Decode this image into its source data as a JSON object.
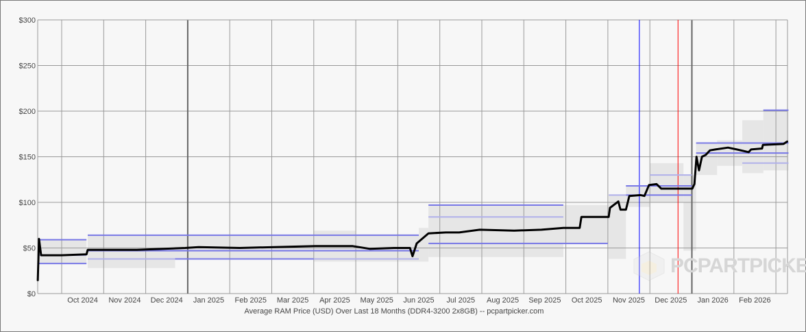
{
  "watermark": "PCPARTPICKER",
  "chart_data": {
    "type": "line",
    "title": "Average RAM Price (USD) Over Last 18 Months (DDR4-3200 2x8GB) -- pcpartpicker.com",
    "xlabel": "Average RAM Price (USD) Over Last 18 Months (DDR4-3200 2x8GB) -- pcpartpicker.com",
    "ylabel": "",
    "x_units": "months since 2024-09-01",
    "xlim": [
      0.43,
      18.36
    ],
    "ylim": [
      0,
      300
    ],
    "grid": true,
    "y_ticks": [
      {
        "value": 0,
        "label": "$0"
      },
      {
        "value": 50,
        "label": "$50"
      },
      {
        "value": 100,
        "label": "$100"
      },
      {
        "value": 150,
        "label": "$150"
      },
      {
        "value": 200,
        "label": "$200"
      },
      {
        "value": 250,
        "label": "$250"
      },
      {
        "value": 300,
        "label": "$300"
      }
    ],
    "x_ticks": [
      {
        "value": 1,
        "label": "Oct 2024"
      },
      {
        "value": 2,
        "label": "Nov 2024"
      },
      {
        "value": 3,
        "label": "Dec 2024"
      },
      {
        "value": 4,
        "label": "Jan 2025"
      },
      {
        "value": 5,
        "label": "Feb 2025"
      },
      {
        "value": 6,
        "label": "Mar 2025"
      },
      {
        "value": 7,
        "label": "Apr 2025"
      },
      {
        "value": 8,
        "label": "May 2025"
      },
      {
        "value": 9,
        "label": "Jun 2025"
      },
      {
        "value": 10,
        "label": "Jul 2025"
      },
      {
        "value": 11,
        "label": "Aug 2025"
      },
      {
        "value": 12,
        "label": "Sep 2025"
      },
      {
        "value": 13,
        "label": "Oct 2025"
      },
      {
        "value": 14,
        "label": "Nov 2025"
      },
      {
        "value": 15,
        "label": "Dec 2025"
      },
      {
        "value": 16,
        "label": "Jan 2026"
      },
      {
        "value": 17,
        "label": "Feb 2026"
      },
      {
        "value": 18,
        "label": ""
      }
    ],
    "year_lines": [
      4,
      16
    ],
    "marker_lines": [
      {
        "x": 14.75,
        "color": "#0000ff"
      },
      {
        "x": 15.67,
        "color": "#ff0000"
      }
    ],
    "range_bands": [
      [
        0.46,
        1.59,
        33,
        59
      ],
      [
        1.62,
        3.7,
        28,
        64
      ],
      [
        3.7,
        7.0,
        38,
        64
      ],
      [
        7.0,
        8.0,
        35,
        69
      ],
      [
        8.0,
        9.5,
        35,
        65
      ],
      [
        9.5,
        9.73,
        35,
        72
      ],
      [
        9.73,
        12.94,
        40,
        97
      ],
      [
        12.94,
        14.02,
        55,
        97
      ],
      [
        14.02,
        14.43,
        38,
        108
      ],
      [
        14.43,
        15.0,
        95,
        118
      ],
      [
        15.0,
        15.8,
        100,
        143
      ],
      [
        15.8,
        16.1,
        47,
        130
      ],
      [
        16.1,
        16.6,
        130,
        165
      ],
      [
        16.6,
        17.2,
        140,
        168
      ],
      [
        17.2,
        17.7,
        132,
        190
      ],
      [
        17.7,
        18.3,
        135,
        201
      ]
    ],
    "retailer_lines": [
      [
        0.46,
        1.59,
        59
      ],
      [
        0.46,
        1.59,
        33
      ],
      [
        0.46,
        1.59,
        42
      ],
      [
        1.62,
        9.5,
        64
      ],
      [
        1.62,
        9.5,
        47
      ],
      [
        1.62,
        9.5,
        38
      ],
      [
        3.7,
        7.0,
        38
      ],
      [
        9.73,
        12.94,
        97
      ],
      [
        9.73,
        12.94,
        84
      ],
      [
        9.73,
        12.94,
        55
      ],
      [
        12.94,
        14.0,
        55
      ],
      [
        14.02,
        14.43,
        108
      ],
      [
        14.43,
        16.0,
        118
      ],
      [
        14.43,
        16.0,
        108
      ],
      [
        15.0,
        16.0,
        130
      ],
      [
        16.1,
        18.3,
        165
      ],
      [
        16.1,
        18.3,
        154
      ],
      [
        17.2,
        18.3,
        143
      ],
      [
        17.7,
        18.3,
        201
      ]
    ],
    "series": [
      {
        "name": "Average price",
        "color": "#000000",
        "points": [
          [
            0.43,
            14
          ],
          [
            0.46,
            60
          ],
          [
            0.51,
            42
          ],
          [
            1.0,
            42
          ],
          [
            1.59,
            43
          ],
          [
            1.62,
            48
          ],
          [
            2.79,
            48
          ],
          [
            3.94,
            50
          ],
          [
            4.26,
            51
          ],
          [
            5.24,
            50
          ],
          [
            6.06,
            51
          ],
          [
            7.04,
            52
          ],
          [
            7.93,
            52
          ],
          [
            8.34,
            49
          ],
          [
            8.91,
            50
          ],
          [
            9.29,
            50
          ],
          [
            9.35,
            41
          ],
          [
            9.45,
            55
          ],
          [
            9.73,
            66
          ],
          [
            10.14,
            67
          ],
          [
            10.46,
            67
          ],
          [
            10.95,
            70
          ],
          [
            11.77,
            69
          ],
          [
            12.42,
            70
          ],
          [
            12.94,
            72
          ],
          [
            13.33,
            72
          ],
          [
            13.37,
            84
          ],
          [
            14.02,
            84
          ],
          [
            14.05,
            94
          ],
          [
            14.25,
            101
          ],
          [
            14.3,
            92
          ],
          [
            14.43,
            92
          ],
          [
            14.51,
            107
          ],
          [
            14.78,
            108
          ],
          [
            14.87,
            107
          ],
          [
            14.98,
            119
          ],
          [
            15.16,
            120
          ],
          [
            15.27,
            115
          ],
          [
            16.01,
            115
          ],
          [
            16.06,
            120
          ],
          [
            16.11,
            150
          ],
          [
            16.17,
            135
          ],
          [
            16.24,
            150
          ],
          [
            16.33,
            152
          ],
          [
            16.43,
            157
          ],
          [
            16.56,
            158
          ],
          [
            16.86,
            160
          ],
          [
            17.07,
            158
          ],
          [
            17.35,
            155
          ],
          [
            17.41,
            158
          ],
          [
            17.67,
            159
          ],
          [
            17.69,
            163
          ],
          [
            18.18,
            164
          ],
          [
            18.28,
            167
          ]
        ]
      }
    ]
  }
}
